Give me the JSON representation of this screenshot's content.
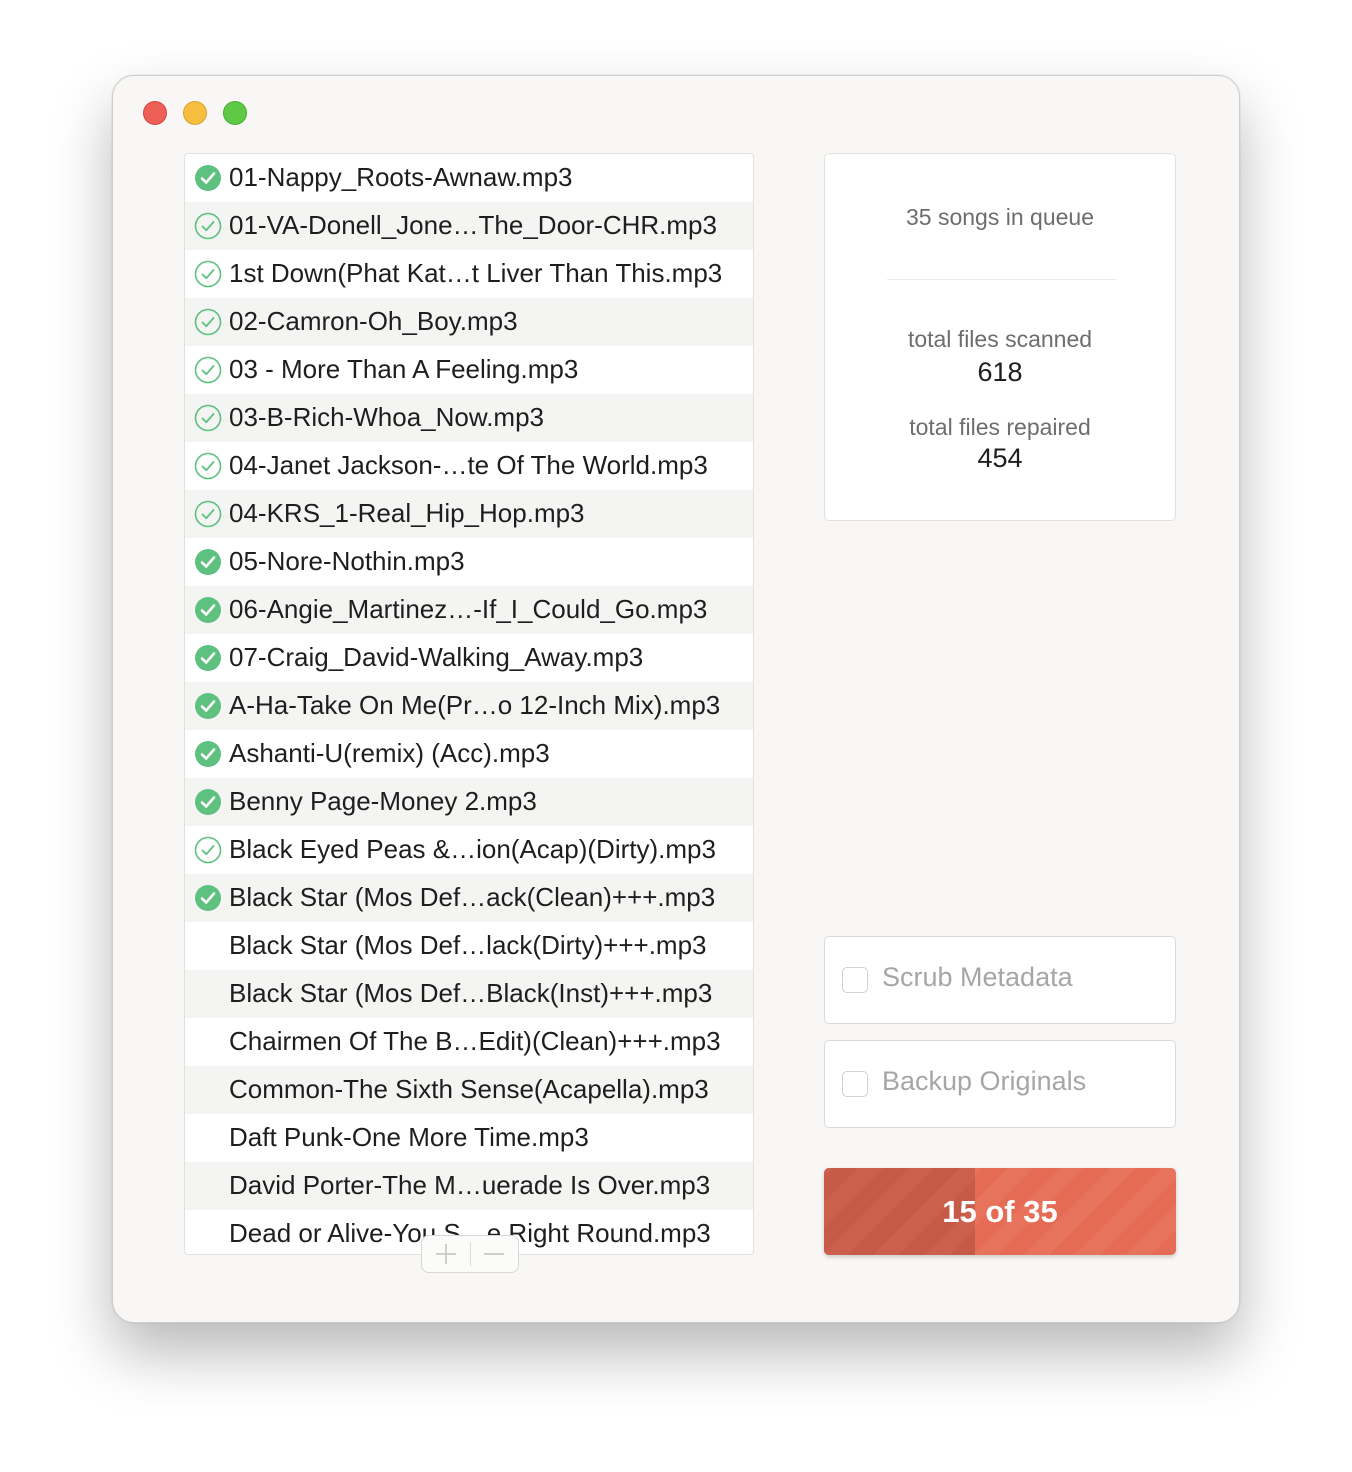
{
  "window": {
    "controls": [
      "close",
      "minimize",
      "zoom"
    ]
  },
  "files": [
    {
      "name": "01-Nappy_Roots-Awnaw.mp3",
      "status": "repaired"
    },
    {
      "name": "01-VA-Donell_Jone…The_Door-CHR.mp3",
      "status": "scanned"
    },
    {
      "name": "1st Down(Phat Kat…t Liver Than This.mp3",
      "status": "scanned"
    },
    {
      "name": "02-Camron-Oh_Boy.mp3",
      "status": "scanned"
    },
    {
      "name": "03 - More Than A Feeling.mp3",
      "status": "scanned"
    },
    {
      "name": "03-B-Rich-Whoa_Now.mp3",
      "status": "scanned"
    },
    {
      "name": "04-Janet Jackson-…te Of The World.mp3",
      "status": "scanned"
    },
    {
      "name": "04-KRS_1-Real_Hip_Hop.mp3",
      "status": "scanned"
    },
    {
      "name": "05-Nore-Nothin.mp3",
      "status": "repaired"
    },
    {
      "name": "06-Angie_Martinez…-If_I_Could_Go.mp3",
      "status": "repaired"
    },
    {
      "name": "07-Craig_David-Walking_Away.mp3",
      "status": "repaired"
    },
    {
      "name": "A-Ha-Take On Me(Pr…o 12-Inch Mix).mp3",
      "status": "repaired"
    },
    {
      "name": "Ashanti-U(remix) (Acc).mp3",
      "status": "repaired"
    },
    {
      "name": "Benny Page-Money 2.mp3",
      "status": "repaired"
    },
    {
      "name": "Black Eyed Peas &…ion(Acap)(Dirty).mp3",
      "status": "scanned"
    },
    {
      "name": "Black Star (Mos Def…ack(Clean)+++.mp3",
      "status": "repaired"
    },
    {
      "name": "Black Star (Mos Def…lack(Dirty)+++.mp3",
      "status": "pending"
    },
    {
      "name": "Black Star (Mos Def…Black(Inst)+++.mp3",
      "status": "pending"
    },
    {
      "name": "Chairmen Of The B…Edit)(Clean)+++.mp3",
      "status": "pending"
    },
    {
      "name": "Common-The Sixth Sense(Acapella).mp3",
      "status": "pending"
    },
    {
      "name": "Daft Punk-One More Time.mp3",
      "status": "pending"
    },
    {
      "name": "David Porter-The M…uerade Is Over.mp3",
      "status": "pending"
    },
    {
      "name": "Dead or Alive-You S…e Right Round.mp3",
      "status": "pending"
    }
  ],
  "list_controls": {
    "add_icon": "plus-icon",
    "remove_icon": "minus-icon"
  },
  "stats": {
    "queue_text": "35 songs in queue",
    "scanned_label": "total files scanned",
    "scanned_value": "618",
    "repaired_label": "total files repaired",
    "repaired_value": "454"
  },
  "options": {
    "scrub_label": "Scrub Metadata",
    "scrub_checked": false,
    "backup_label": "Backup Originals",
    "backup_checked": false
  },
  "progress": {
    "label": "15 of 35",
    "current": 15,
    "total": 35
  },
  "colors": {
    "check_green": "#5dc17f",
    "progress_bar": "#e56b55",
    "progress_fill": "#c65a48"
  }
}
